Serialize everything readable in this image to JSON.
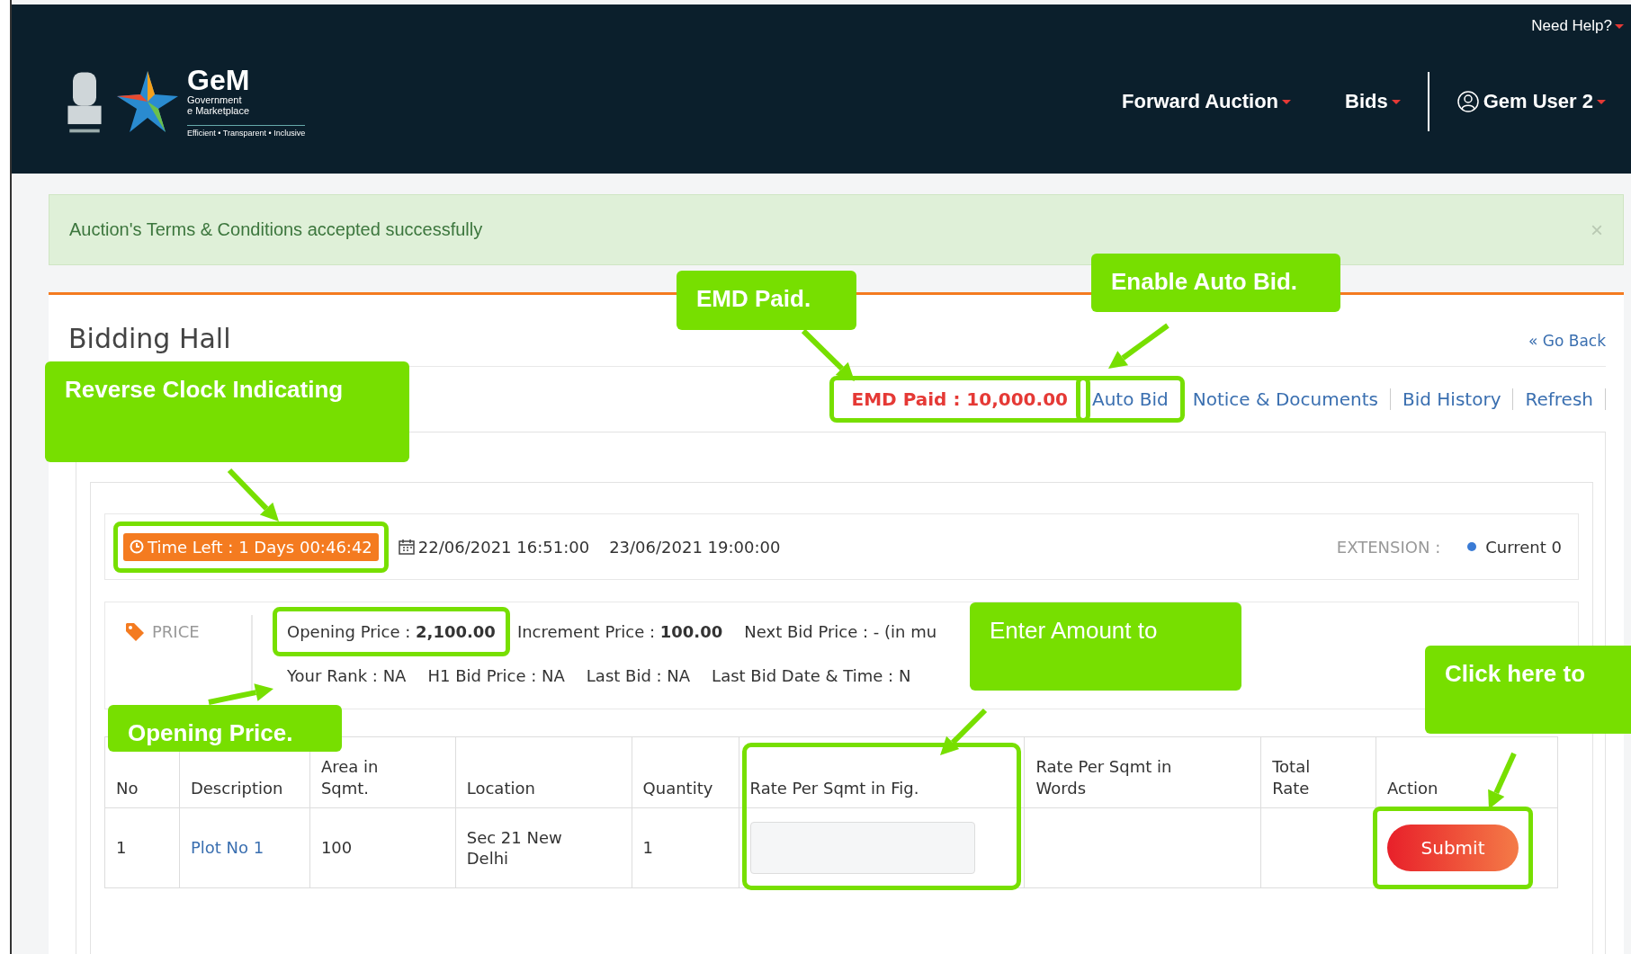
{
  "header": {
    "need_help": "Need Help?",
    "logo": {
      "name": "GeM",
      "line1": "Government",
      "line2": "e Marketplace",
      "tagline": "Efficient • Transparent • Inclusive"
    },
    "nav": [
      {
        "label": "Forward Auction"
      },
      {
        "label": "Bids"
      }
    ],
    "user": "Gem User 2"
  },
  "alert": {
    "message": "Auction's Terms & Conditions accepted successfully",
    "close": "×"
  },
  "page": {
    "title": "Bidding Hall",
    "go_back": "« Go Back"
  },
  "links": [
    {
      "label": "EMD Paid : 10,000.00",
      "kind": "emd"
    },
    {
      "label": "Auto Bid",
      "kind": "link"
    },
    {
      "label": "Notice & Documents",
      "kind": "link"
    },
    {
      "label": "Bid History",
      "kind": "link"
    },
    {
      "label": "Refresh",
      "kind": "link"
    }
  ],
  "timer": {
    "time_left": "Time Left : 1 Days 00:46:42",
    "start": "22/06/2021 16:51:00",
    "end": "23/06/2021 19:00:00",
    "extension_label": "EXTENSION :",
    "extension_value": "Current 0"
  },
  "price": {
    "label": "PRICE",
    "row1": [
      "Opening Price : **2,100.00**",
      "Increment Price : **100.00**",
      "Next Bid Price : - (in mu"
    ],
    "row2": [
      "Your Rank : NA",
      "H1 Bid Price : NA",
      "Last Bid : NA",
      "Last Bid Date & Time : N"
    ]
  },
  "table": {
    "columns": [
      "No",
      "Description",
      "Area in Sqmt.",
      "Location",
      "Quantity",
      "Rate Per Sqmt in Fig.",
      "Rate Per Sqmt in Words",
      "Total Rate",
      "Action"
    ],
    "rows": [
      {
        "no": "1",
        "description": "Plot No 1",
        "area": "100",
        "location": "Sec 21 New Delhi",
        "quantity": "1",
        "action": "Submit"
      }
    ]
  },
  "callouts": [
    {
      "text": "EMD Paid."
    },
    {
      "text": "Enable Auto Bid."
    },
    {
      "text": "Reverse Clock Indicating"
    },
    {
      "text": "Enter Amount to"
    },
    {
      "text": "Click here to"
    },
    {
      "text": "Opening Price."
    }
  ]
}
